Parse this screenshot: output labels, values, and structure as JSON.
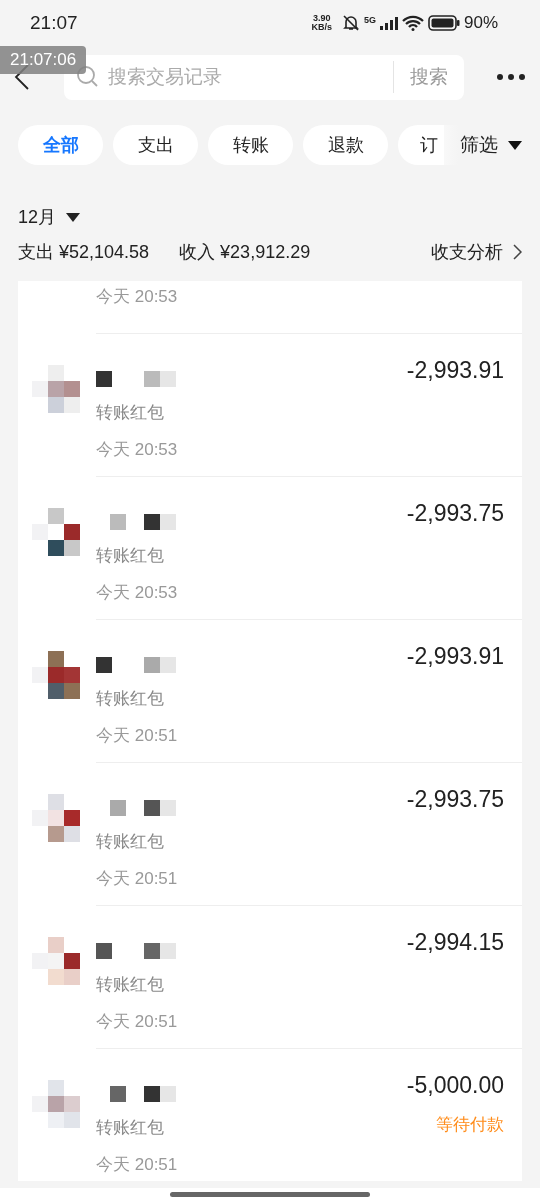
{
  "status_bar": {
    "time": "21:07",
    "net_speed": [
      "3.90",
      "KB/s"
    ],
    "network": "5G",
    "battery": "90%"
  },
  "recording_timestamp": "21:07:06",
  "search": {
    "placeholder": "搜索交易记录",
    "button": "搜索"
  },
  "filters": [
    {
      "label": "全部",
      "selected": true
    },
    {
      "label": "支出",
      "selected": false
    },
    {
      "label": "转账",
      "selected": false
    },
    {
      "label": "退款",
      "selected": false
    },
    {
      "label": "订",
      "selected": false
    }
  ],
  "filter_menu": "筛选",
  "month": "12月",
  "summary": {
    "expense": "支出 ¥52,104.58",
    "income": "收入 ¥23,912.29",
    "analysis": "收支分析"
  },
  "transactions": [
    {
      "kind": "partial",
      "time": "今天 20:53"
    },
    {
      "kind": "full",
      "amount": "-2,993.91",
      "category": "转账红包",
      "time": "今天 20:53"
    },
    {
      "kind": "full",
      "amount": "-2,993.75",
      "category": "转账红包",
      "time": "今天 20:53"
    },
    {
      "kind": "full",
      "amount": "-2,993.91",
      "category": "转账红包",
      "time": "今天 20:51"
    },
    {
      "kind": "full",
      "amount": "-2,993.75",
      "category": "转账红包",
      "time": "今天 20:51"
    },
    {
      "kind": "full",
      "amount": "-2,994.15",
      "category": "转账红包",
      "time": "今天 20:51"
    },
    {
      "kind": "full",
      "amount": "-5,000.00",
      "category": "转账红包",
      "time": "今天 20:51",
      "status": "等待付款"
    }
  ]
}
